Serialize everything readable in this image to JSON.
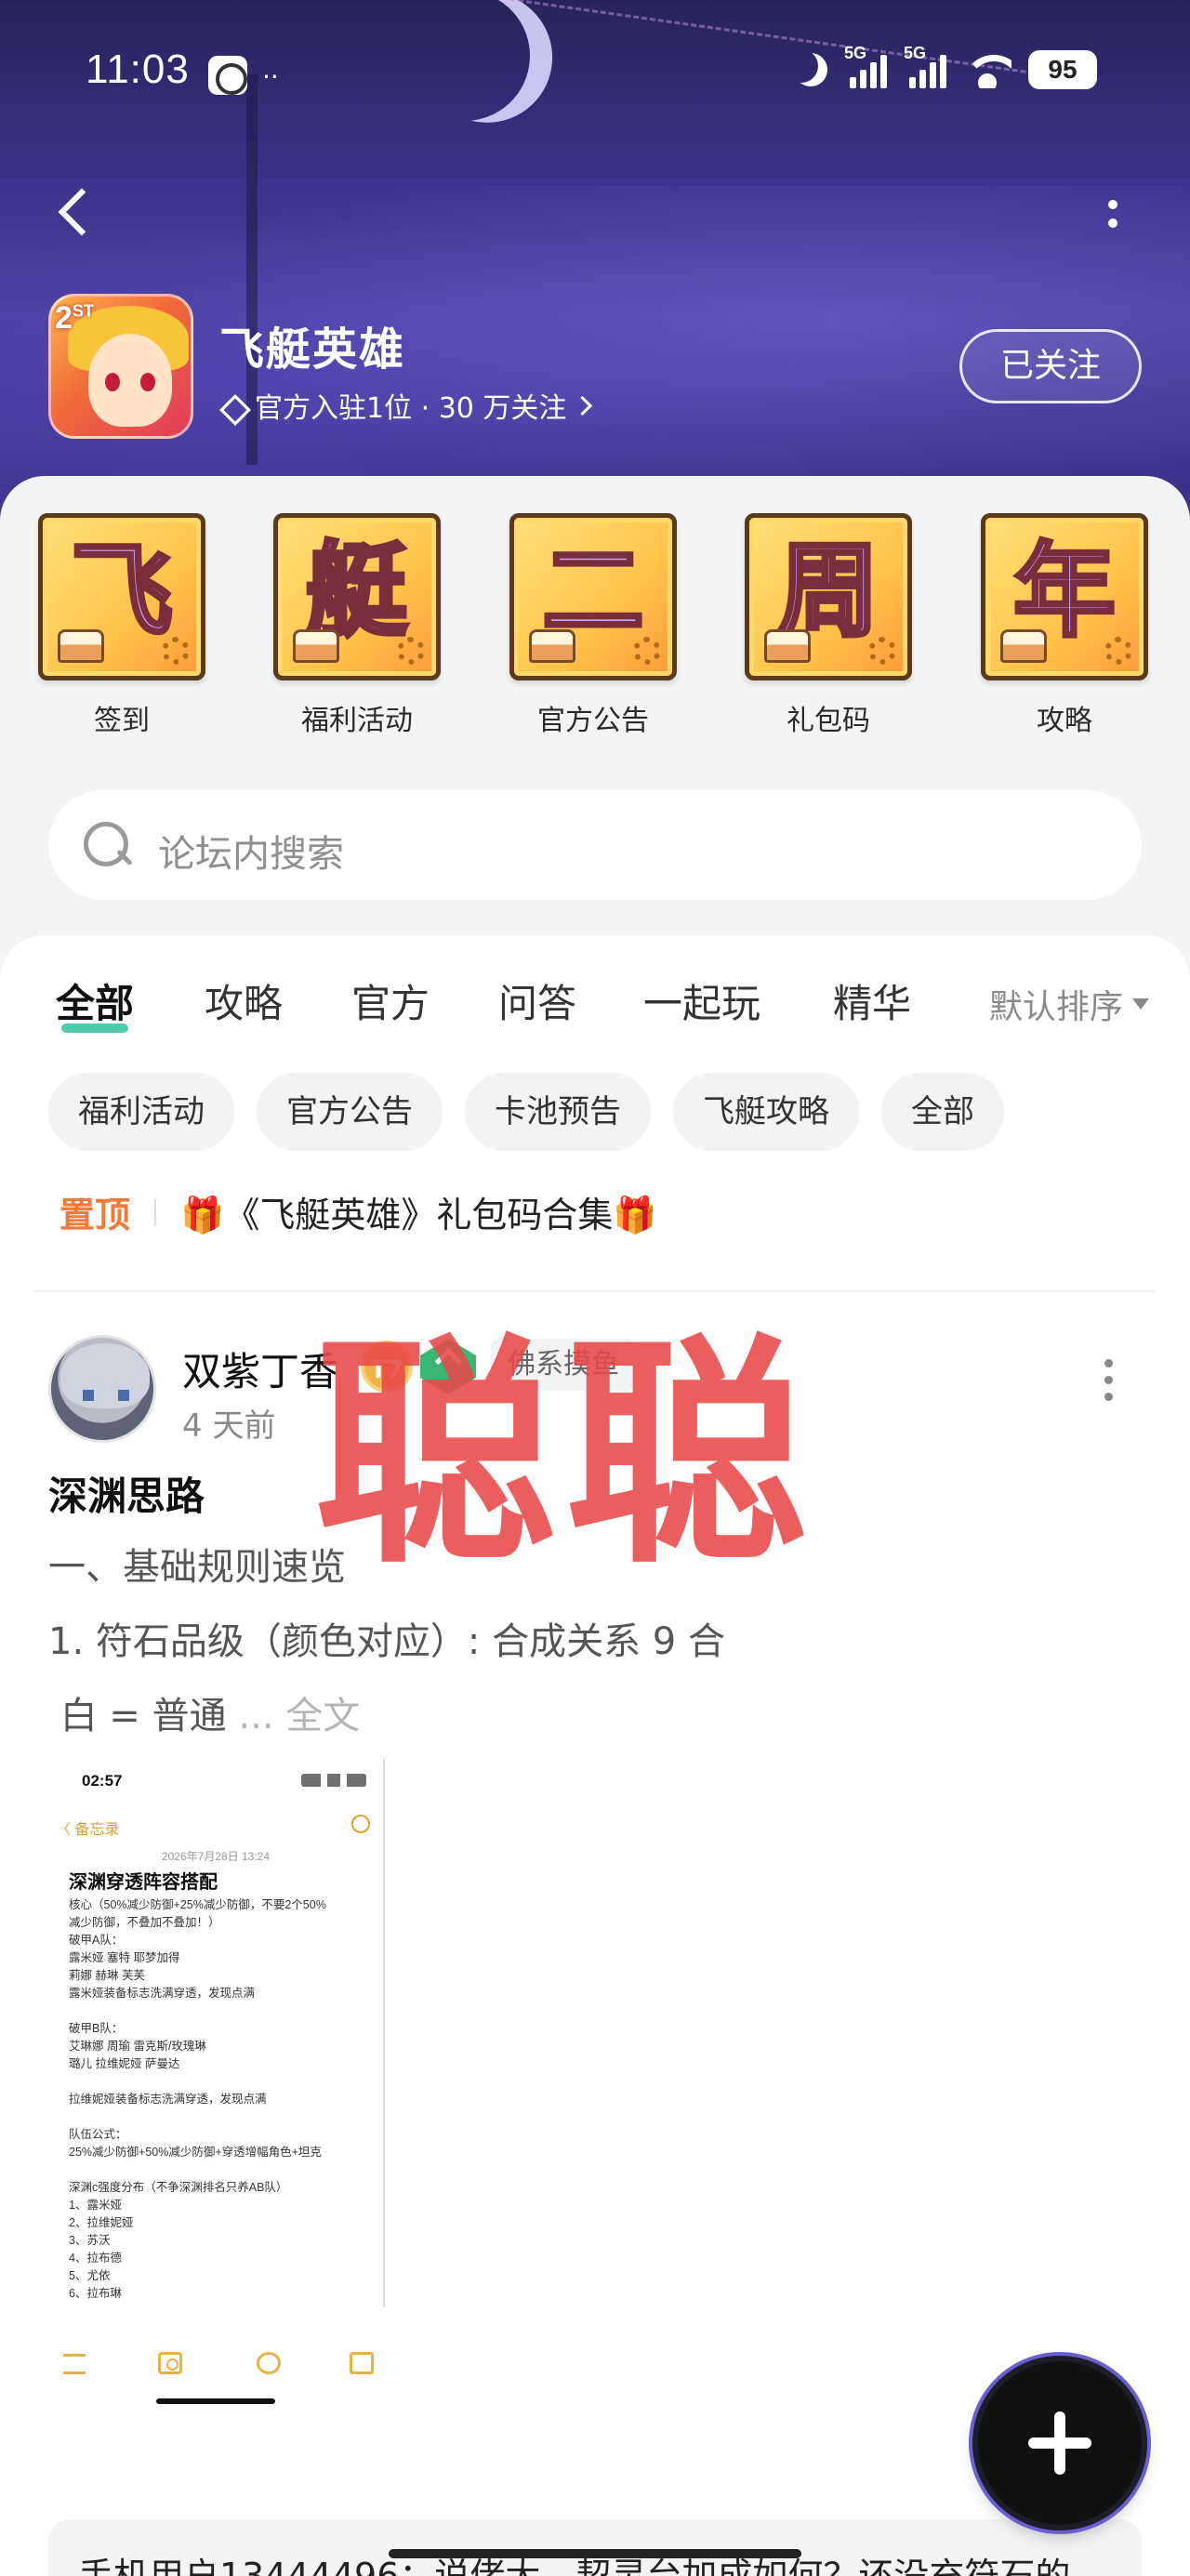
{
  "status_bar": {
    "time": "11:03",
    "extra": "··",
    "sim1": "5G",
    "sim2": "5G",
    "battery": "95"
  },
  "header": {
    "game_title": "飞艇英雄",
    "logo_badge": "2",
    "logo_badge_sup": "ST",
    "meta": "官方入驻1位 · 30 万关注",
    "follow_label": "已关注"
  },
  "shortcuts": [
    {
      "glyph": "飞",
      "label": "签到"
    },
    {
      "glyph": "艇",
      "label": "福利活动"
    },
    {
      "glyph": "二",
      "label": "官方公告"
    },
    {
      "glyph": "周",
      "label": "礼包码"
    },
    {
      "glyph": "年",
      "label": "攻略"
    }
  ],
  "search": {
    "placeholder": "论坛内搜索"
  },
  "tabs": [
    "全部",
    "攻略",
    "官方",
    "问答",
    "一起玩",
    "精华"
  ],
  "sort_label": "默认排序",
  "chips": [
    "福利活动",
    "官方公告",
    "卡池预告",
    "飞艇攻略",
    "全部"
  ],
  "pinned": {
    "tag": "置顶",
    "text": "🎁《飞艇英雄》礼包码合集🎁"
  },
  "post": {
    "author": "双紫丁香",
    "level": "7",
    "user_tag": "佛系摸鱼",
    "time": "4 天前",
    "title": "深渊思路",
    "line1": "一、基础规则速览",
    "line2": "1. 符石品级（颜色对应）: 合成关系 9 合",
    "line3": "白 = 普通",
    "more": "... 全文",
    "watermark": "聪聪"
  },
  "thumbnail": {
    "time": "02:57",
    "back": "〈 备忘录",
    "date": "2026年7月28日 13:24",
    "heading": "深渊穿透阵容搭配",
    "lines": "核心（50%减少防御+25%减少防御，不要2个50%\n减少防御，不叠加不叠加！）\n破甲A队：\n露米娅 塞特 耶梦加得\n莉娜 赫琳 芙芙\n露米娅装备标志洗满穿透，发现点满\n\n破甲B队：\n艾琳娜 周瑜 雷克斯/玫瑰琳\n璐儿 拉维妮娅 萨曼达\n\n拉维妮娅装备标志洗满穿透，发现点满\n\n队伍公式：\n25%减少防御+50%减少防御+穿透增幅角色+坦克\n\n深渊c强度分布（不争深渊排名只养AB队）\n1、露米娅\n2、拉维妮娅\n3、苏沃\n4、拉布德\n5、尤依\n6、拉布琳"
  },
  "comment": {
    "text": "手机用户13444496：说佬大，契灵台加成如何？还没充符石的"
  },
  "colors": {
    "accent": "#2ec4a0",
    "pinned": "#f07a3a",
    "watermark": "#e84848",
    "header_bg": "#3c338a"
  },
  "icons": [
    "back-icon",
    "more-icon",
    "diamond-icon",
    "chevron-right-icon",
    "search-icon",
    "caret-down-icon",
    "post-more-icon",
    "list-icon",
    "camera-icon",
    "pen-icon",
    "edit-icon",
    "plus-icon"
  ]
}
